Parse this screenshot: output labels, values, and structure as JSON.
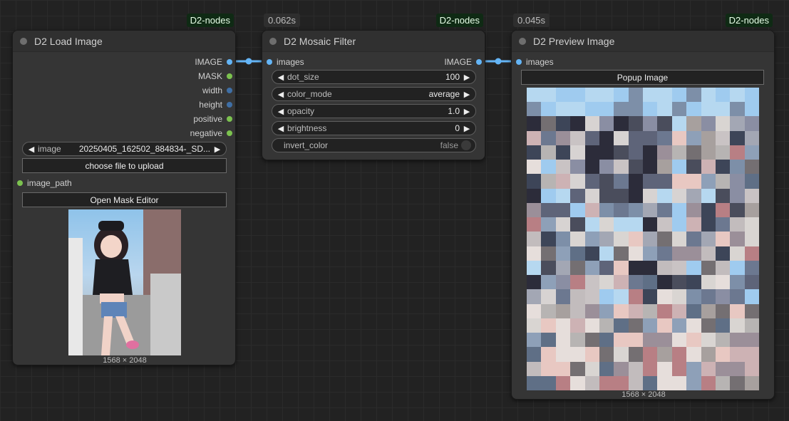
{
  "nodes": {
    "load_image": {
      "badge": "D2-nodes",
      "title": "D2 Load Image",
      "outputs": [
        {
          "label": "IMAGE",
          "color": "#64b5f6"
        },
        {
          "label": "MASK",
          "color": "#7cc24f"
        },
        {
          "label": "width",
          "color": "#3f6fa6"
        },
        {
          "label": "height",
          "color": "#3f6fa6"
        },
        {
          "label": "positive",
          "color": "#7cc24f"
        },
        {
          "label": "negative",
          "color": "#7cc24f"
        }
      ],
      "image_widget": {
        "label": "image",
        "value": "20250405_162502_884834-_SD..."
      },
      "upload_button": "choose file to upload",
      "input_image_path": "image_path",
      "mask_button": "Open Mask Editor",
      "preview_caption": "1568 × 2048"
    },
    "mosaic": {
      "badge": "D2-nodes",
      "timing": "0.062s",
      "title": "D2 Mosaic Filter",
      "input_images": "images",
      "output_image": "IMAGE",
      "widgets": [
        {
          "label": "dot_size",
          "value": "100"
        },
        {
          "label": "color_mode",
          "value": "average"
        },
        {
          "label": "opacity",
          "value": "1.0"
        },
        {
          "label": "brightness",
          "value": "0"
        }
      ],
      "toggle": {
        "label": "invert_color",
        "value": "false"
      }
    },
    "preview": {
      "badge": "D2-nodes",
      "timing": "0.045s",
      "title": "D2 Preview Image",
      "input_images": "images",
      "popup_button": "Popup Image",
      "preview_caption": "1568 × 2048"
    }
  },
  "icons": {
    "arrow_left": "◀",
    "arrow_right": "▶"
  },
  "colors": {
    "link": "#64b5f6",
    "badge_bg": "#0f2a14",
    "node_bg": "#353535"
  }
}
